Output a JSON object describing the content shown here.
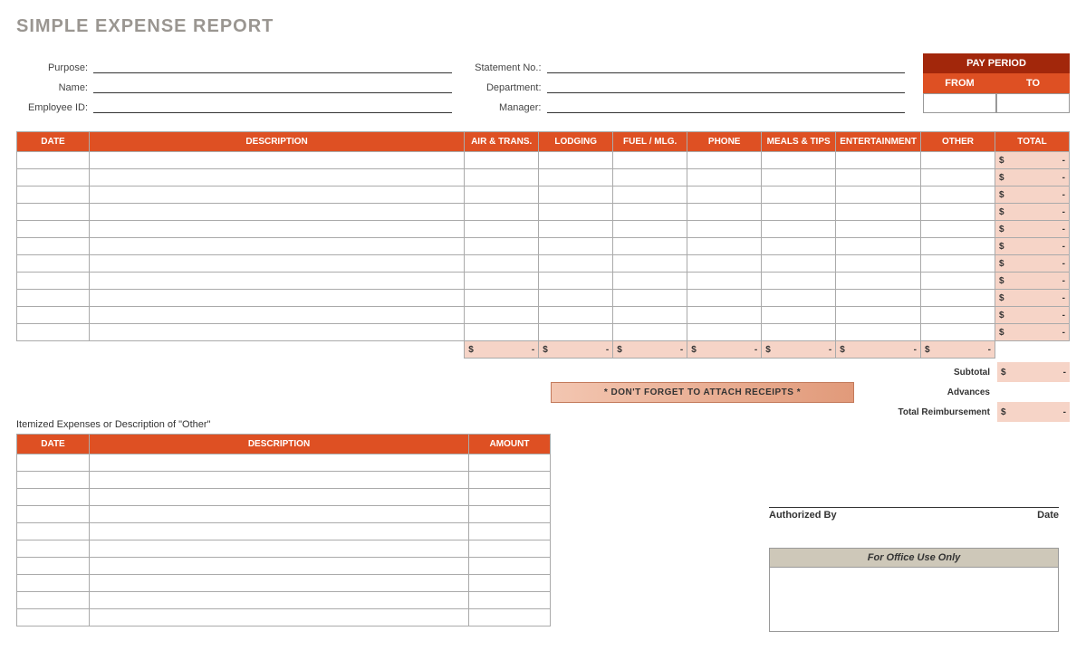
{
  "title": "SIMPLE EXPENSE REPORT",
  "info_left": [
    {
      "label": "Purpose:"
    },
    {
      "label": "Name:"
    },
    {
      "label": "Employee ID:"
    }
  ],
  "info_right": [
    {
      "label": "Statement No.:"
    },
    {
      "label": "Department:"
    },
    {
      "label": "Manager:"
    }
  ],
  "pay_period": {
    "head": "PAY PERIOD",
    "from": "FROM",
    "to": "TO"
  },
  "main_headers": [
    "DATE",
    "DESCRIPTION",
    "AIR & TRANS.",
    "LODGING",
    "FUEL / MLG.",
    "PHONE",
    "MEALS & TIPS",
    "ENTERTAINMENT",
    "OTHER",
    "TOTAL"
  ],
  "main_rows": 11,
  "total_cell": {
    "cur": "$",
    "val": "-"
  },
  "colsums": [
    {
      "cur": "$",
      "val": "-"
    },
    {
      "cur": "$",
      "val": "-"
    },
    {
      "cur": "$",
      "val": "-"
    },
    {
      "cur": "$",
      "val": "-"
    },
    {
      "cur": "$",
      "val": "-"
    },
    {
      "cur": "$",
      "val": "-"
    },
    {
      "cur": "$",
      "val": "-"
    }
  ],
  "summary": [
    {
      "label": "Subtotal",
      "cur": "$",
      "val": "-",
      "shaded": true
    },
    {
      "label": "Advances",
      "shaded": false
    },
    {
      "label": "Total Reimbursement",
      "cur": "$",
      "val": "-",
      "shaded": true
    }
  ],
  "receipts": "* DON'T FORGET TO ATTACH RECEIPTS *",
  "itemized_title": "Itemized Expenses or Description of \"Other\"",
  "item_headers": [
    "DATE",
    "DESCRIPTION",
    "AMOUNT"
  ],
  "item_rows": 10,
  "sig": {
    "auth": "Authorized By",
    "date": "Date"
  },
  "office": "For Office Use Only"
}
